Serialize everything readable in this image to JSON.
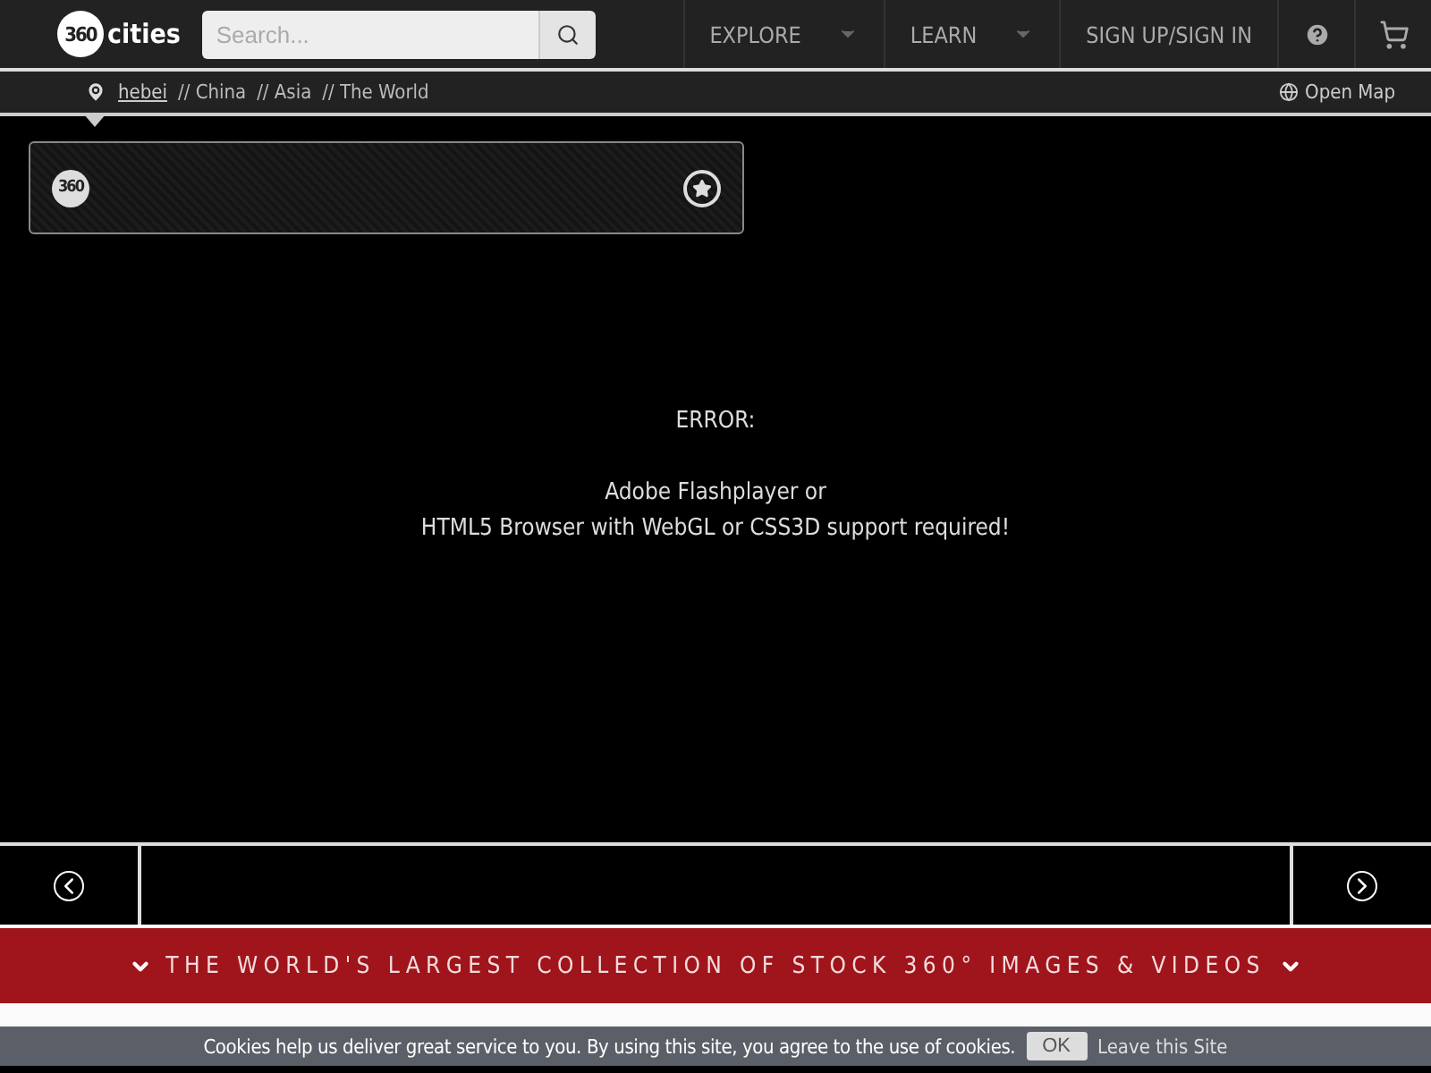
{
  "header": {
    "logo": {
      "badge": "360",
      "name": "cities"
    },
    "search": {
      "placeholder": "Search..."
    },
    "nav": [
      {
        "label": "EXPLORE",
        "kind": "dropdown"
      },
      {
        "label": "LEARN",
        "kind": "dropdown"
      },
      {
        "label": "SIGN UP/SIGN IN",
        "kind": "link"
      }
    ]
  },
  "breadcrumb": {
    "items": [
      {
        "label": "hebei",
        "kind": "link"
      },
      {
        "label": "// China",
        "kind": "text"
      },
      {
        "label": "// Asia",
        "kind": "text"
      },
      {
        "label": "// The World",
        "kind": "text"
      }
    ],
    "map_link": "Open Map"
  },
  "viewer": {
    "badge": "360",
    "error_title": "ERROR:",
    "error_lines": [
      "Adobe Flashplayer or",
      "HTML5 Browser with WebGL or CSS3D support required!"
    ]
  },
  "banner": "THE WORLD'S LARGEST COLLECTION OF STOCK 360° IMAGES & VIDEOS",
  "cookie_bar": {
    "message": "Cookies help us deliver great service to you. By using this site, you agree to the use of cookies.",
    "ok": "OK",
    "leave": "Leave this Site"
  }
}
